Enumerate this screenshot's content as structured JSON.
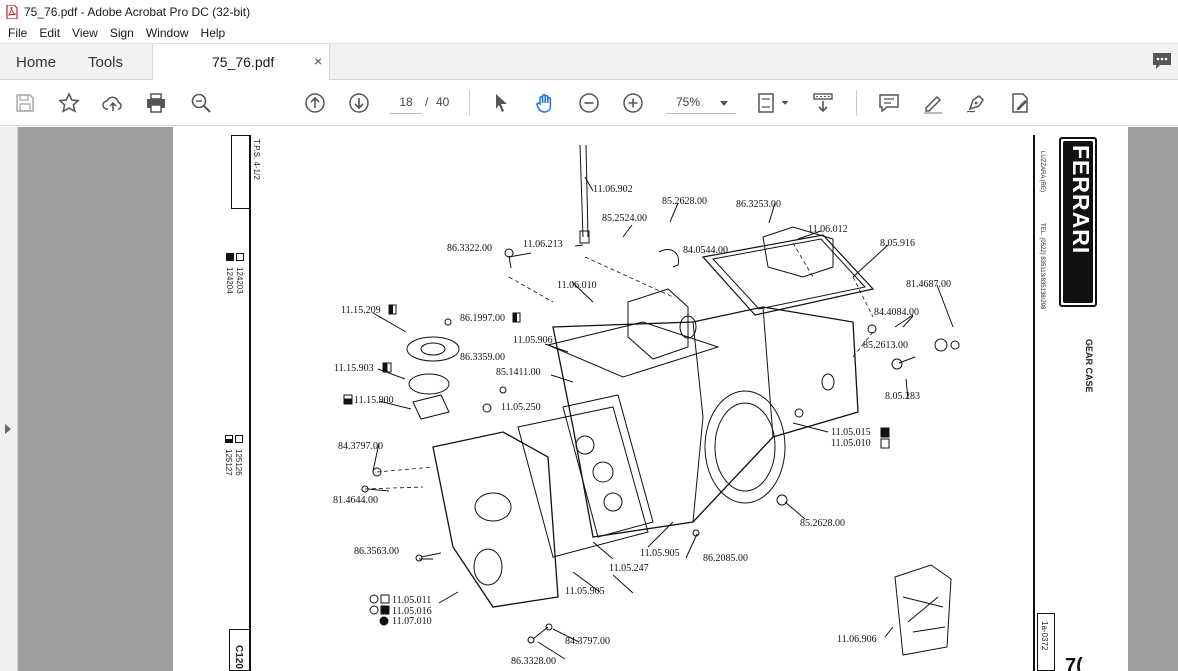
{
  "window": {
    "title": "75_76.pdf - Adobe Acrobat Pro DC (32-bit)"
  },
  "menu": [
    "File",
    "Edit",
    "View",
    "Sign",
    "Window",
    "Help"
  ],
  "tabs": {
    "home": "Home",
    "tools": "Tools",
    "document": "75_76.pdf",
    "close": "×"
  },
  "toolbar": {
    "page_current": "18",
    "page_separator": "/",
    "page_total": "40",
    "zoom": "75%"
  },
  "document": {
    "brand": "FERRARI",
    "title": "GEAR CASE",
    "left_margin": {
      "top_box": "T.P.S. 4-1/2",
      "serial_1a": "124204",
      "serial_1b": "124203",
      "serial_2a": "125127",
      "serial_2b": "125126",
      "code": "C120"
    },
    "right_margin": {
      "address": "LUZZARA (RE)",
      "phone": "TEL. (0522) 835113/835138/298",
      "catalog_code": "1a-0372"
    },
    "part_labels": [
      "11.06.902",
      "85.2628.00",
      "86.3253.00",
      "85.2524.00",
      "11.06.213",
      "84.0544.00",
      "11.06.012",
      "86.3322.00",
      "8.05.916",
      "81.4687.00",
      "11.06.010",
      "11.15.209",
      "86.1997.00",
      "84.4084.00",
      "11.05.906",
      "85.2613.00",
      "86.3359.00",
      "11.15.903",
      "85.1411.00",
      "8.05.283",
      "11.15.900",
      "11.05.250",
      "11.05.015",
      "11.05.010",
      "84.3797.00",
      "81.4644.00",
      "85.2628.00",
      "11.05.905",
      "86.2085.00",
      "86.3563.00",
      "11.05.247",
      "11.05.905",
      "11.05.011",
      "11.05.016",
      "11.07.010",
      "84.3797.00",
      "11.06.906",
      "86.3328.00"
    ]
  },
  "colors": {
    "accent": "#1473e6",
    "workspace": "#9d9d9d",
    "pdf_icon": "#d4202a"
  }
}
